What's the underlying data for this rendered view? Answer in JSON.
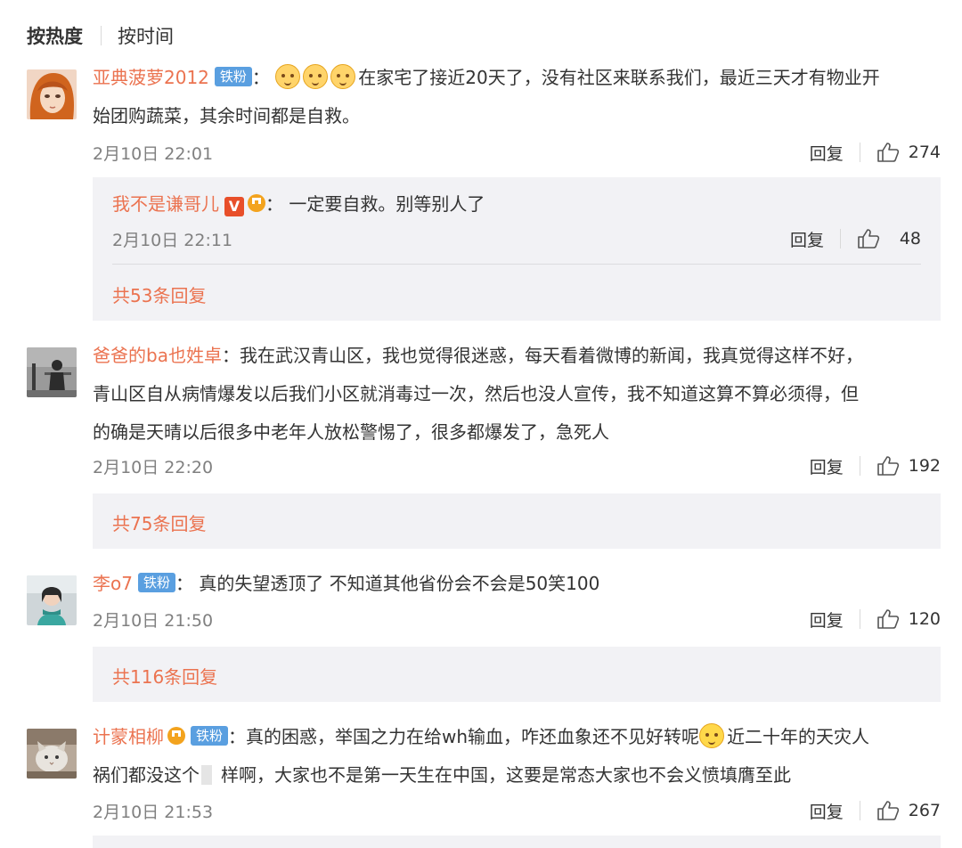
{
  "sort_tabs": {
    "hot": "按热度",
    "time": "按时间"
  },
  "badges": {
    "tiefen": "铁粉",
    "v": "V"
  },
  "reply_label": "回复",
  "comments": [
    {
      "user": "亚典菠萝2012",
      "text_line1": "在家宅了接近20天了，没有社区来联系我们，最近三天才有物业开",
      "text_line2": "始团购蔬菜，其余时间都是自救。",
      "date": "2月10日 22:01",
      "likes": "274",
      "sub_reply": {
        "user": "我不是谦哥儿",
        "text": "：  一定要自救。别等别人了",
        "date": "2月10日 22:11",
        "likes": "48"
      },
      "more": "共53条回复"
    },
    {
      "user": "爸爸的ba也姓卓",
      "text_line1": "：我在武汉青山区，我也觉得很迷惑，每天看着微博的新闻，我真觉得这样不好，",
      "text_line2": "青山区自从病情爆发以后我们小区就消毒过一次，然后也没人宣传，我不知道这算不算必须得，但",
      "text_line3": "的确是天晴以后很多中老年人放松警惕了，很多都爆发了，急死人",
      "date": "2月10日 22:20",
      "likes": "192",
      "more": "共75条回复"
    },
    {
      "user": "李o7",
      "text_line1": "：  真的失望透顶了  不知道其他省份会不会是50笑100",
      "date": "2月10日 21:50",
      "likes": "120",
      "more": "共116条回复"
    },
    {
      "user": "计蒙相柳",
      "text_line1a": "：真的困惑，举国之力在给wh输血，咋还血象还不见好转呢",
      "text_line1b": "近二十年的天灾人",
      "text_line2a": "祸们都没这个",
      "text_line2b": "样啊，大家也不是第一天生在中国，这要是常态大家也不会义愤填膺至此",
      "date": "2月10日 21:53",
      "likes": "267"
    }
  ]
}
